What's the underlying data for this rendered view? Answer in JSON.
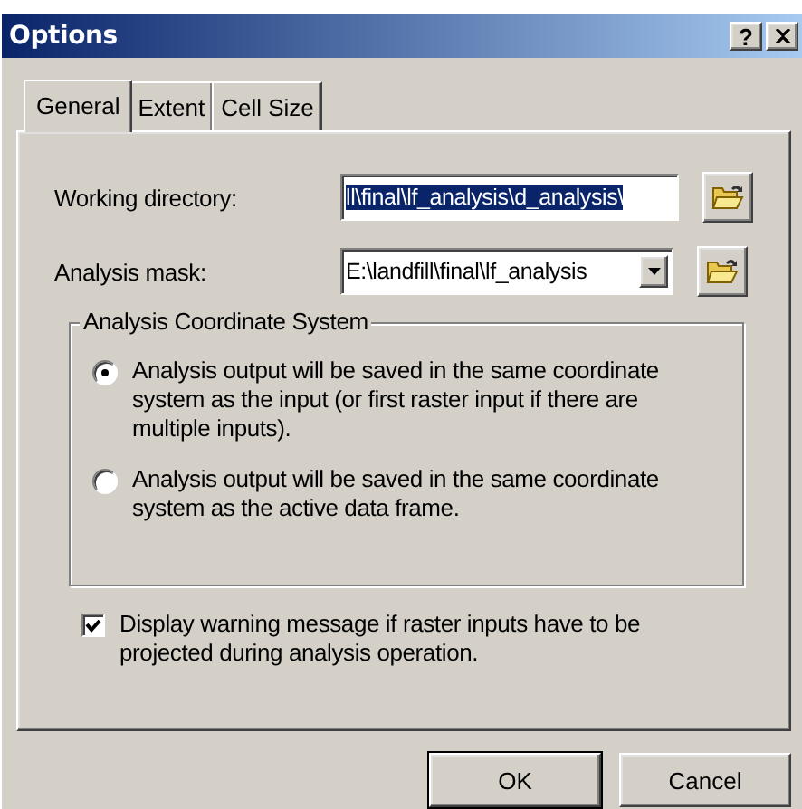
{
  "window": {
    "title": "Options",
    "help": "?"
  },
  "tabs": [
    {
      "label": "General",
      "selected": true
    },
    {
      "label": "Extent",
      "selected": false
    },
    {
      "label": "Cell Size",
      "selected": false
    }
  ],
  "fields": [
    {
      "label": "Working directory:",
      "kind": "text",
      "value": "ll\\final\\lf_analysis\\d_analysis\\",
      "highlighted": true
    },
    {
      "label": "Analysis mask:",
      "kind": "combo",
      "value": "E:\\landfill\\final\\lf_analysis",
      "highlighted": false
    }
  ],
  "coordinate_system": {
    "title": "Analysis Coordinate System",
    "options": [
      {
        "label": "Analysis output will be saved in the same coordinate system as the input (or first raster input if there are multiple inputs).",
        "selected": true
      },
      {
        "label": "Analysis output will be saved in the same coordinate system as the active data frame.",
        "selected": false
      }
    ]
  },
  "warning": {
    "label": "Display warning message if raster inputs have to be projected during analysis operation.",
    "checked": true
  },
  "buttons": [
    {
      "label": "OK",
      "default": true
    },
    {
      "label": "Cancel",
      "default": false
    }
  ]
}
